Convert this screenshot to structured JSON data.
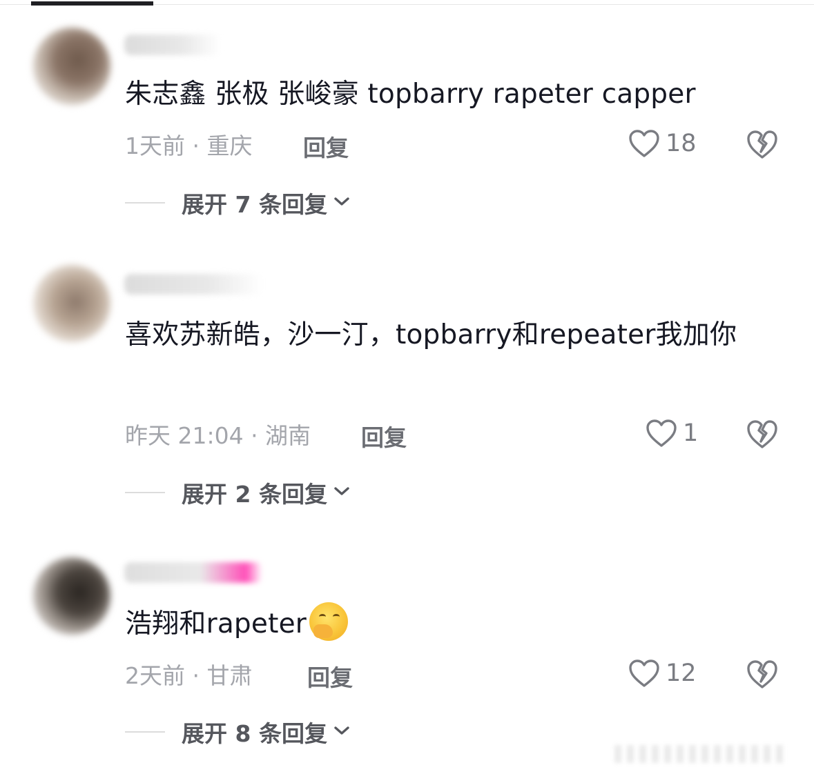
{
  "comments": [
    {
      "username": "",
      "text": "朱志鑫  张极  张峻豪  topbarry  rapeter capper",
      "meta": "1天前 · 重庆",
      "reply": "回复",
      "likes": "18",
      "expand": "展开 7 条回复"
    },
    {
      "username": "",
      "text": "喜欢苏新皓，沙一汀，topbarry和repeater我加你",
      "meta": "昨天 21:04 · 湖南",
      "reply": "回复",
      "likes": "1",
      "expand": "展开 2 条回复"
    },
    {
      "username": "",
      "text": "浩翔和rapeter",
      "meta": "2天前 · 甘肃",
      "reply": "回复",
      "likes": "12",
      "expand": "展开 8 条回复"
    }
  ],
  "icons": {
    "like": "heart-outline-icon",
    "dislike": "broken-heart-icon",
    "expand": "chevron-down-icon",
    "emoji": "hand-over-mouth-emoji"
  },
  "colors": {
    "text": "#161823",
    "meta": "#a3a5ab",
    "reply": "#6b6d73"
  }
}
